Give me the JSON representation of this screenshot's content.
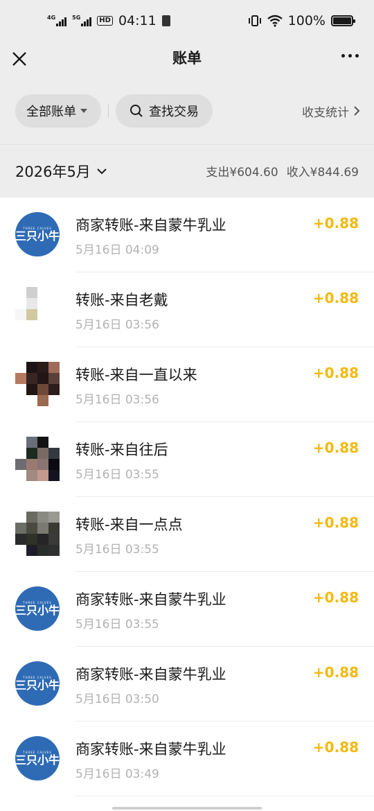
{
  "status_bar": {
    "time": "04:11",
    "net1": "4G",
    "net2": "5G",
    "hd": "HD",
    "battery": "100%"
  },
  "nav": {
    "title": "账单"
  },
  "filters": {
    "all_bills": "全部账单",
    "search": "查找交易",
    "stats": "收支统计"
  },
  "summary": {
    "month": "2026年5月",
    "expense": "支出¥604.60",
    "income": "收入¥844.69"
  },
  "transactions": [
    {
      "title": "商家转账-来自蒙牛乳业",
      "time": "5月16日 04:09",
      "amount": "+0.88",
      "avatar": "logo"
    },
    {
      "title": "转账-来自老戴",
      "time": "5月16日 03:56",
      "amount": "+0.88",
      "avatar": "mosaic"
    },
    {
      "title": "转账-来自一直以来",
      "time": "5月16日 03:56",
      "amount": "+0.88",
      "avatar": "mosaic"
    },
    {
      "title": "转账-来自往后",
      "time": "5月16日 03:55",
      "amount": "+0.88",
      "avatar": "mosaic"
    },
    {
      "title": "转账-来自一点点",
      "time": "5月16日 03:55",
      "amount": "+0.88",
      "avatar": "mosaic"
    },
    {
      "title": "商家转账-来自蒙牛乳业",
      "time": "5月16日 03:55",
      "amount": "+0.88",
      "avatar": "logo"
    },
    {
      "title": "商家转账-来自蒙牛乳业",
      "time": "5月16日 03:50",
      "amount": "+0.88",
      "avatar": "logo"
    },
    {
      "title": "商家转账-来自蒙牛乳业",
      "time": "5月16日 03:49",
      "amount": "+0.88",
      "avatar": "logo"
    }
  ],
  "merchant_logo": {
    "small_text": "THREE CALVES",
    "big_text": "三只小牛"
  },
  "colors": {
    "amount": "#f3b90e",
    "logo_bg": "#2f6bb5",
    "page_bg": "#ededed"
  }
}
